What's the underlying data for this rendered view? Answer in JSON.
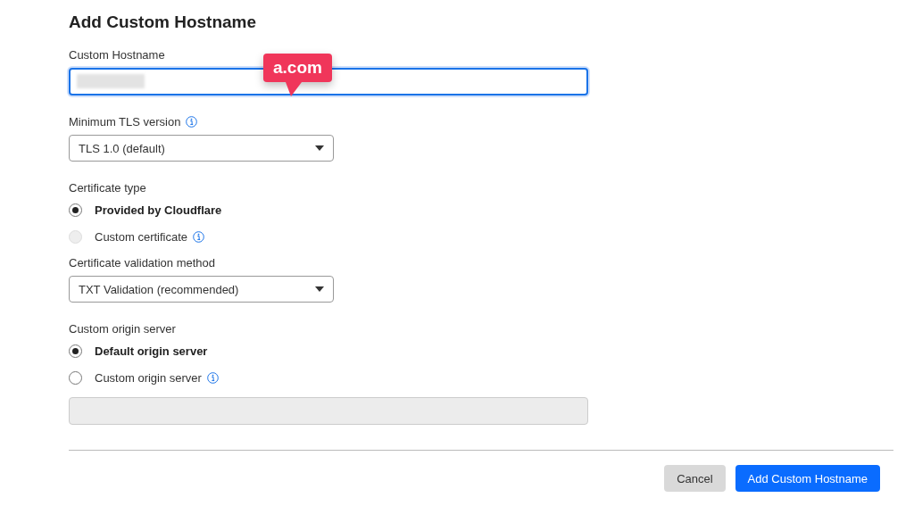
{
  "title": "Add Custom Hostname",
  "fields": [
    {
      "kind": "text",
      "label": "Custom Hostname",
      "focused": true,
      "disabled": false,
      "redacted": true
    },
    {
      "kind": "select",
      "label": "Minimum TLS version",
      "info": true,
      "value": "TLS 1.0 (default)"
    },
    {
      "kind": "radio",
      "label": "Certificate type",
      "options": [
        {
          "label": "Provided by Cloudflare",
          "selected": true,
          "disabled": false
        },
        {
          "label": "Custom certificate",
          "selected": false,
          "disabled": true,
          "info": true
        }
      ]
    },
    {
      "kind": "select",
      "label": "Certificate validation method",
      "value": "TXT Validation (recommended)"
    },
    {
      "kind": "radio",
      "label": "Custom origin server",
      "options": [
        {
          "label": "Default origin server",
          "selected": true,
          "disabled": false
        },
        {
          "label": "Custom origin server",
          "selected": false,
          "disabled": false,
          "info": true
        }
      ]
    },
    {
      "kind": "text",
      "focused": false,
      "disabled": true
    }
  ],
  "callout": {
    "text": "a.com"
  },
  "buttons": [
    {
      "label": "Cancel",
      "kind": "secondary"
    },
    {
      "label": "Add Custom Hostname",
      "kind": "primary"
    }
  ]
}
